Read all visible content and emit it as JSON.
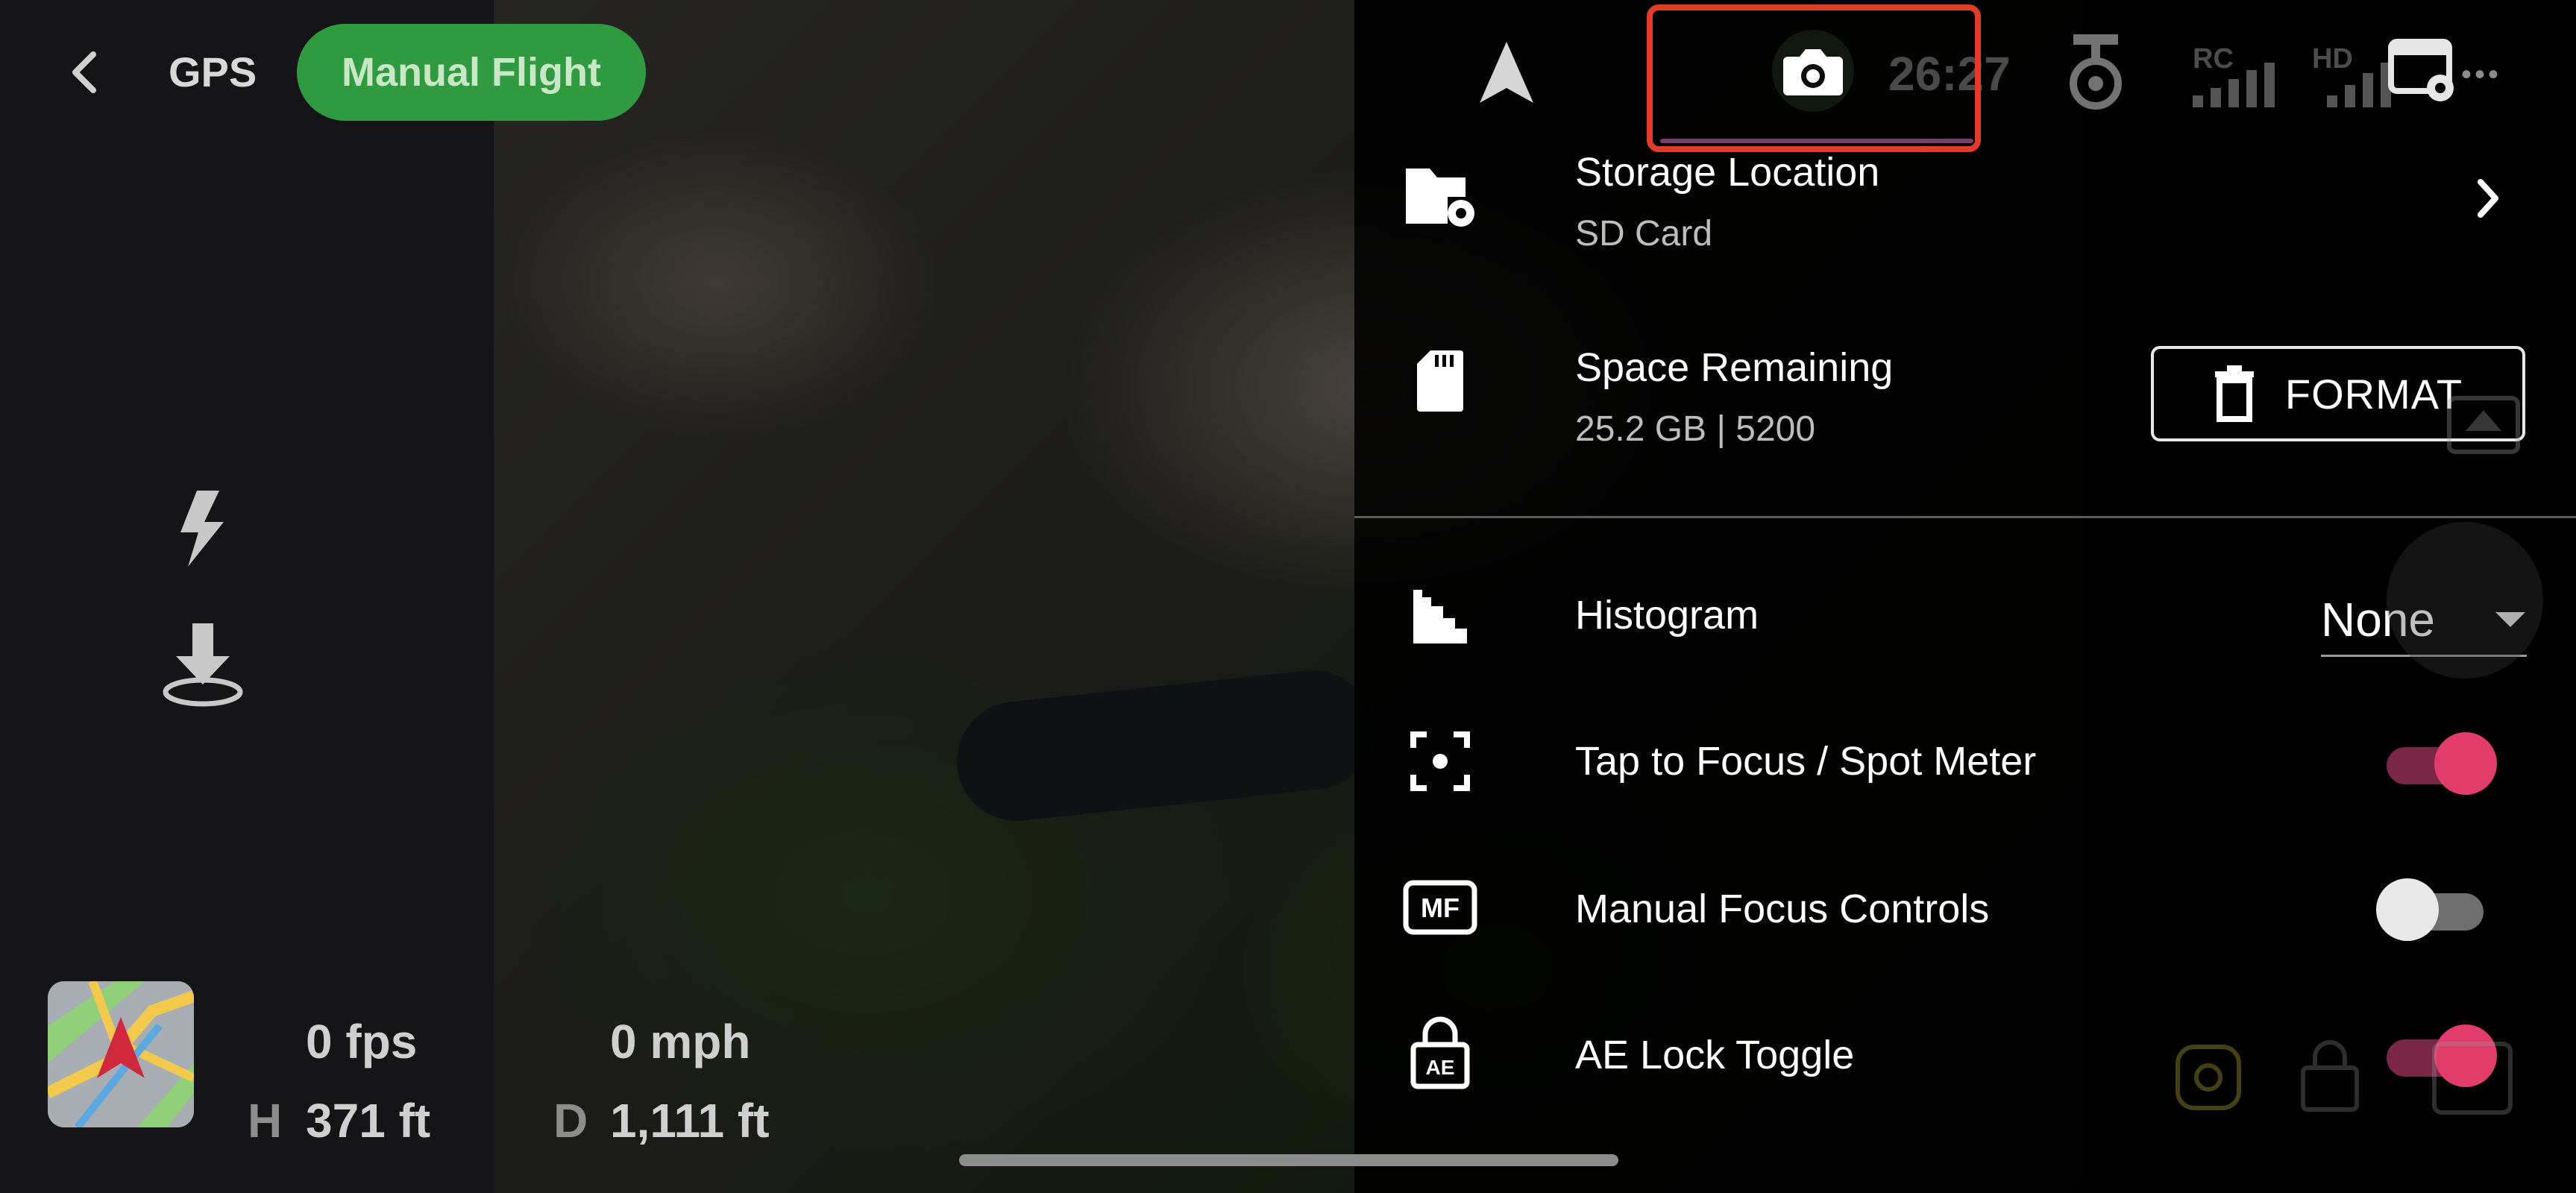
{
  "header": {
    "gps_label": "GPS",
    "flight_mode": "Manual Flight",
    "timer": "26:27",
    "rc_label": "RC",
    "hd_label": "HD",
    "more": "•••"
  },
  "telemetry": {
    "fps": "0 fps",
    "height_key": "H",
    "height": "371 ft",
    "speed": "0 mph",
    "distance_key": "D",
    "distance": "1,111 ft"
  },
  "tabs": [
    {
      "id": "navigation",
      "icon": "navigation-arrow-icon"
    },
    {
      "id": "camera",
      "icon": "camera-icon",
      "active": true
    }
  ],
  "settings": {
    "storage": {
      "title": "Storage Location",
      "subtitle": "SD Card"
    },
    "space": {
      "title": "Space Remaining",
      "subtitle": "25.2 GB | 5200",
      "button": "FORMAT"
    },
    "histogram": {
      "title": "Histogram",
      "value": "None"
    },
    "tap_focus": {
      "title": "Tap to Focus / Spot Meter",
      "enabled": true
    },
    "manual_focus": {
      "title": "Manual Focus Controls",
      "enabled": false
    },
    "ae_lock": {
      "title": "AE Lock Toggle",
      "enabled": true,
      "icon_text": "AE"
    }
  },
  "icons": {
    "mf_text": "MF",
    "ae_text": "AE"
  },
  "colors": {
    "accent_pink": "#e23d6a",
    "highlight_red": "#e33b2a",
    "pill_green": "#2f9a40"
  }
}
